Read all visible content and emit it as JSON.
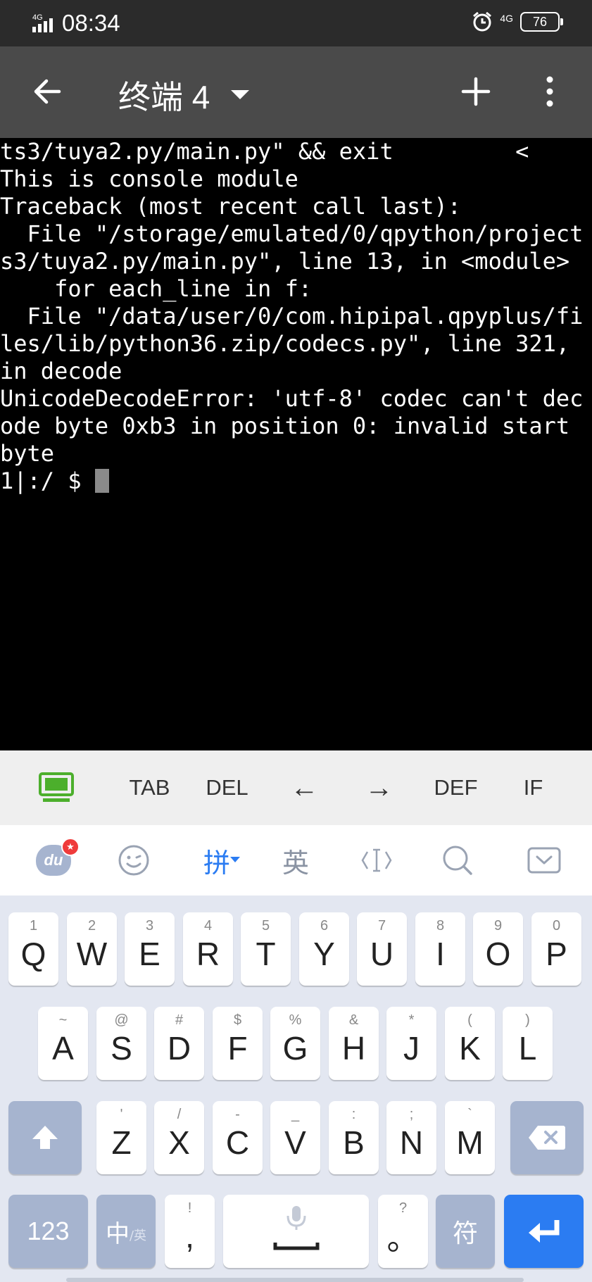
{
  "status": {
    "time": "08:34",
    "network_left": "4G",
    "network_right": "4G",
    "battery": "76"
  },
  "toolbar": {
    "title": "终端 4"
  },
  "terminal": {
    "lines": [
      "ts3/tuya2.py/main.py\" && exit         <",
      "This is console module",
      "Traceback (most recent call last):",
      "  File \"/storage/emulated/0/qpython/project",
      "s3/tuya2.py/main.py\", line 13, in <module>",
      "    for each_line in f:",
      "  File \"/data/user/0/com.hipipal.qpyplus/fi",
      "les/lib/python36.zip/codecs.py\", line 321,",
      "in decode",
      "UnicodeDecodeError: 'utf-8' codec can't dec",
      "ode byte 0xb3 in position 0: invalid start",
      "byte"
    ],
    "prompt": "1|:/ $ "
  },
  "extra_keys": {
    "tab": "TAB",
    "del": "DEL",
    "left": "←",
    "right": "→",
    "def": "DEF",
    "if": "IF"
  },
  "ime": {
    "logo": "du",
    "pinyin": "拼",
    "english": "英"
  },
  "keys": {
    "row1": [
      {
        "main": "Q",
        "sub": "1"
      },
      {
        "main": "W",
        "sub": "2"
      },
      {
        "main": "E",
        "sub": "3"
      },
      {
        "main": "R",
        "sub": "4"
      },
      {
        "main": "T",
        "sub": "5"
      },
      {
        "main": "Y",
        "sub": "6"
      },
      {
        "main": "U",
        "sub": "7"
      },
      {
        "main": "I",
        "sub": "8"
      },
      {
        "main": "O",
        "sub": "9"
      },
      {
        "main": "P",
        "sub": "0"
      }
    ],
    "row2": [
      {
        "main": "A",
        "sub": "~"
      },
      {
        "main": "S",
        "sub": "@"
      },
      {
        "main": "D",
        "sub": "#"
      },
      {
        "main": "F",
        "sub": "$"
      },
      {
        "main": "G",
        "sub": "%"
      },
      {
        "main": "H",
        "sub": "&"
      },
      {
        "main": "J",
        "sub": "*"
      },
      {
        "main": "K",
        "sub": "("
      },
      {
        "main": "L",
        "sub": ")"
      }
    ],
    "row3": [
      {
        "main": "Z",
        "sub": "'"
      },
      {
        "main": "X",
        "sub": "/"
      },
      {
        "main": "C",
        "sub": "-"
      },
      {
        "main": "V",
        "sub": "_"
      },
      {
        "main": "B",
        "sub": ":"
      },
      {
        "main": "N",
        "sub": ";"
      },
      {
        "main": "M",
        "sub": "`"
      }
    ],
    "num": "123",
    "lang_main": "中",
    "lang_sub": "/英",
    "comma_main": ",",
    "comma_sub": "!",
    "period_main": "。",
    "period_sub": "?",
    "symbol": "符"
  }
}
